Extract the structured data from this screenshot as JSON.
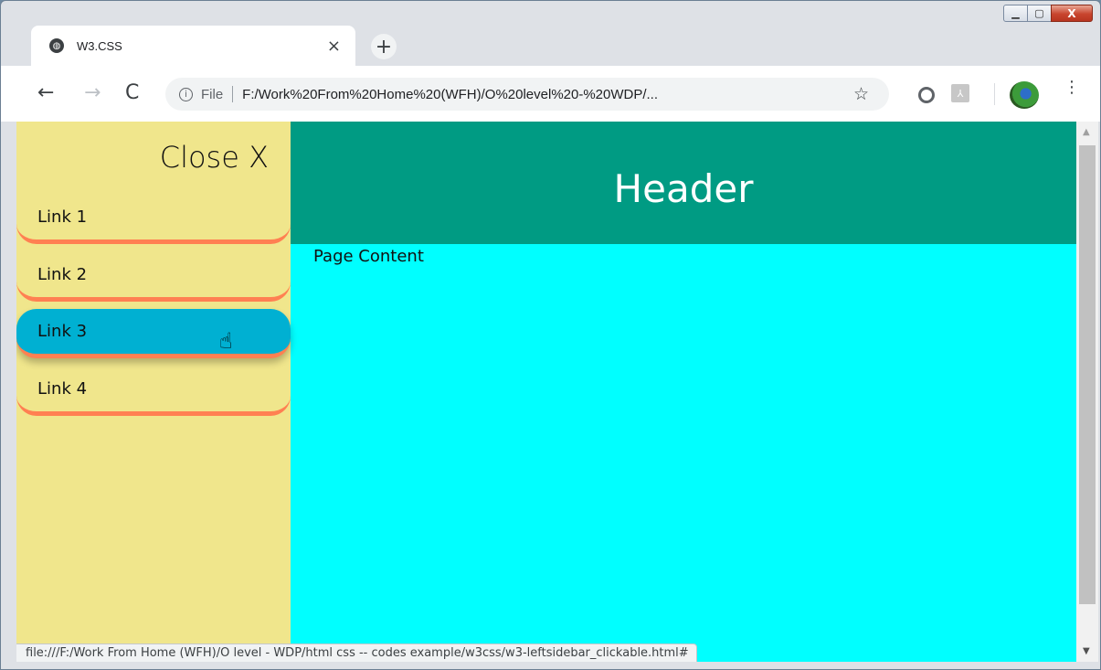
{
  "window": {
    "min_icon": "minimize-icon",
    "max_icon": "maximize-icon",
    "close_label": "X"
  },
  "tab": {
    "title": "W3.CSS",
    "favicon": "globe-icon",
    "close_label": "×",
    "new_tab_label": "+"
  },
  "toolbar": {
    "back": "←",
    "forward": "→",
    "reload": "C",
    "file_label": "File",
    "url": "F:/Work%20From%20Home%20(WFH)/O%20level%20-%20WDP/...",
    "star": "☆",
    "menu": "⋮"
  },
  "sidebar": {
    "close_label": "Close X",
    "links": [
      {
        "label": "Link 1"
      },
      {
        "label": "Link 2"
      },
      {
        "label": "Link 3"
      },
      {
        "label": "Link 4"
      }
    ],
    "active_index": 2
  },
  "main": {
    "header": "Header",
    "content": "Page Content"
  },
  "status_bar": {
    "text": "file:///F:/Work From Home (WFH)/O level - WDP/html css -- codes example/w3css/w3-leftsidebar_clickable.html#"
  },
  "colors": {
    "sidebar_bg": "#f0e68c",
    "link_border": "#ff8052",
    "active_link": "#00b0d2",
    "header_bg": "#009b83",
    "content_bg": "#00ffff"
  }
}
